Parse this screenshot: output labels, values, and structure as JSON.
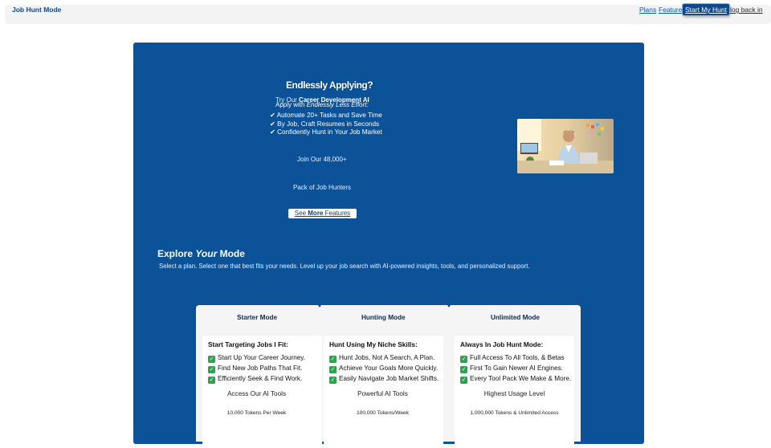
{
  "header": {
    "brand": "Job Hunt Mode",
    "nav": {
      "plans": "Plans",
      "features": "Features",
      "start": "Start My Hunt",
      "login": "log back in"
    }
  },
  "hero": {
    "title": "Endlessly Applying?",
    "try_prefix": "Try Our ",
    "try_bold": "Career Development AI",
    "apply_prefix": "Apply with ",
    "apply_italic": "Endlessly Less Effort:",
    "benefits": [
      "✔ Automate 20+ Tasks and Save Time",
      "✔ By Job, Craft Resumes in Seconds",
      "✔ Confidently Hunt in Your Job Market"
    ],
    "join": "Join Our 48,000+",
    "pack": "Pack of Job Hunters",
    "button": {
      "see": "See ",
      "more": "More",
      "features": " Features"
    }
  },
  "explore": {
    "title_prefix": "Explore ",
    "title_italic": "Your",
    "title_suffix": " Mode",
    "subtitle": "Select a plan. Select one that best fits your needs. Level up your job search with AI-powered insights, tools, and personalized support."
  },
  "plans": [
    {
      "tab": "Starter Mode",
      "heading": "Start Targeting Jobs I Fit:",
      "features": [
        "Start Up Your Career Journey.",
        "Find New Job Paths That Fit.",
        "Efficiently Seek & Find Work."
      ],
      "tool": "Access Our AI Tools",
      "tokens": "10,000 Tokens Per Week"
    },
    {
      "tab": "Hunting Mode",
      "heading": "Hunt Using My Niche Skills:",
      "features": [
        "Hunt Jobs, Not A Search, A Plan.",
        "Achieve Your Goals More Quickly.",
        "Easily Navigate Job Market Shifts."
      ],
      "tool": "Powerful AI Tools",
      "tokens": "100,000 Tokens/Week"
    },
    {
      "tab": "Unlimited Mode",
      "heading": "Always In Job Hunt Mode:",
      "features": [
        "Full Access To All Tools, & Betas",
        "First To Gain Newer AI Engines.",
        "Every Tool Pack We Make & More."
      ],
      "tool": "Highest Usage Level",
      "tokens": "1,000,000 Tokens & Unlimited Access"
    }
  ],
  "colors": {
    "brand_blue": "#0b5298",
    "nav_blue": "#0b4a8f",
    "check_green": "#2ea44f"
  }
}
